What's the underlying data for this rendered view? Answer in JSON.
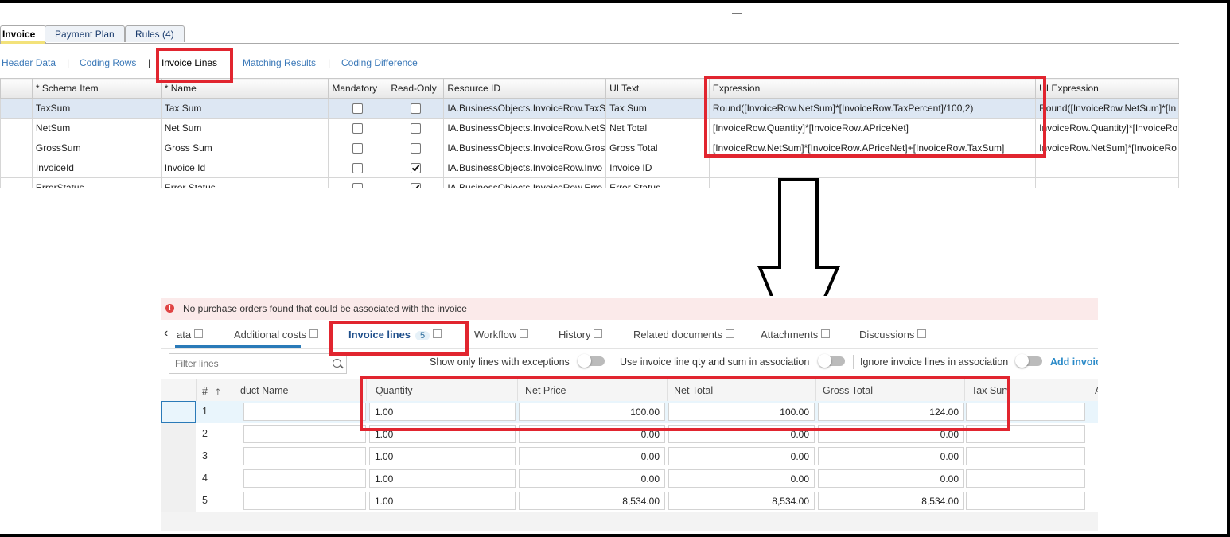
{
  "top": {
    "tabs": [
      "Invoice",
      "Payment Plan",
      "Rules (4)"
    ],
    "subnav": [
      "Header Data",
      "Coding Rows",
      "Invoice Lines",
      "Matching Results",
      "Coding Difference"
    ],
    "columns": [
      "* Schema Item",
      "* Name",
      "Mandatory",
      "Read-Only",
      "Resource ID",
      "UI Text",
      "Expression",
      "UI Expression"
    ],
    "rows": [
      {
        "schema": "TaxSum",
        "name": "Tax Sum",
        "mandatory": false,
        "readonly": false,
        "resource": "IA.BusinessObjects.InvoiceRow.TaxS",
        "uitext": "Tax Sum",
        "expression": "Round([InvoiceRow.NetSum]*[InvoiceRow.TaxPercent]/100,2)",
        "uiexpr": "Round([InvoiceRow.NetSum]*[In"
      },
      {
        "schema": "NetSum",
        "name": "Net Sum",
        "mandatory": false,
        "readonly": false,
        "resource": "IA.BusinessObjects.InvoiceRow.NetS",
        "uitext": "Net Total",
        "expression": "[InvoiceRow.Quantity]*[InvoiceRow.APriceNet]",
        "uiexpr": "InvoiceRow.Quantity]*[InvoiceRo"
      },
      {
        "schema": "GrossSum",
        "name": "Gross Sum",
        "mandatory": false,
        "readonly": false,
        "resource": "IA.BusinessObjects.InvoiceRow.Gros",
        "uitext": "Gross Total",
        "expression": "[InvoiceRow.NetSum]*[InvoiceRow.APriceNet]+[InvoiceRow.TaxSum]",
        "uiexpr": "InvoiceRow.NetSum]*[InvoiceRo"
      },
      {
        "schema": "InvoiceId",
        "name": "Invoice Id",
        "mandatory": false,
        "readonly": true,
        "resource": "IA.BusinessObjects.InvoiceRow.Invo",
        "uitext": "Invoice ID",
        "expression": "",
        "uiexpr": ""
      },
      {
        "schema": "ErrorStatus",
        "name": "Error Status",
        "mandatory": false,
        "readonly": true,
        "resource": "IA.BusinessObjects.InvoiceRow.Erro",
        "uitext": "Error Status",
        "expression": "",
        "uiexpr": ""
      }
    ]
  },
  "bottom": {
    "alert": "No purchase orders found that could be associated with the invoice",
    "tabs": [
      "ata",
      "Additional costs",
      "Invoice lines",
      "Workflow",
      "History",
      "Related documents",
      "Attachments",
      "Discussions"
    ],
    "invoice_lines_count": "5",
    "filter_placeholder": "Filter lines",
    "options": [
      "Show only lines with exceptions",
      "Use invoice line qty and sum in association",
      "Ignore invoice lines in association"
    ],
    "add_link": "Add invoic",
    "columns": [
      "#",
      "duct Name",
      "Quantity",
      "Net Price",
      "Net Total",
      "Gross Total",
      "Tax Sum",
      "A"
    ],
    "rows": [
      {
        "n": "1",
        "qty": "1.00",
        "price": "100.00",
        "net": "100.00",
        "gross": "124.00"
      },
      {
        "n": "2",
        "qty": "1.00",
        "price": "0.00",
        "net": "0.00",
        "gross": "0.00"
      },
      {
        "n": "3",
        "qty": "1.00",
        "price": "0.00",
        "net": "0.00",
        "gross": "0.00"
      },
      {
        "n": "4",
        "qty": "1.00",
        "price": "0.00",
        "net": "0.00",
        "gross": "0.00"
      },
      {
        "n": "5",
        "qty": "1.00",
        "price": "8,534.00",
        "net": "8,534.00",
        "gross": "8,534.00"
      }
    ]
  },
  "colors": {
    "highlight": "#e1252f",
    "link": "#3a78b8",
    "alert_bg": "#fbeaea"
  }
}
